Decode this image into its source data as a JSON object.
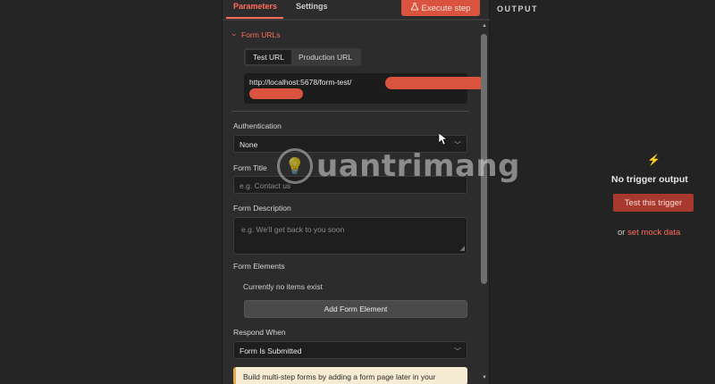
{
  "tabs": {
    "parameters": "Parameters",
    "settings": "Settings"
  },
  "execute_step": {
    "label": "Execute step",
    "icon": "flask-icon"
  },
  "form_urls": {
    "section_label": "Form URLs",
    "test_tab": "Test URL",
    "production_tab": "Production URL",
    "url_text": "http://localhost:5678/form-test/"
  },
  "authentication": {
    "label": "Authentication",
    "value": "None"
  },
  "form_title": {
    "label": "Form Title",
    "placeholder": "e.g. Contact us"
  },
  "form_description": {
    "label": "Form Description",
    "placeholder": "e.g. We'll get back to you soon"
  },
  "form_elements": {
    "label": "Form Elements",
    "empty_text": "Currently no items exist",
    "add_button": "Add Form Element"
  },
  "respond_when": {
    "label": "Respond When",
    "value": "Form Is Submitted"
  },
  "notice": {
    "text": "Build multi-step forms by adding a form page later in your"
  },
  "output": {
    "title": "OUTPUT",
    "empty_title": "No trigger output",
    "test_button": "Test this trigger",
    "mock_prefix": "or",
    "mock_link": "set mock data"
  },
  "watermark": {
    "text": "uantrimang"
  },
  "colors": {
    "accent": "#ff6d5a",
    "execute_bg": "#d9533f",
    "test_btn_bg": "#a8392e",
    "notice_bg": "#f6ebd3"
  }
}
